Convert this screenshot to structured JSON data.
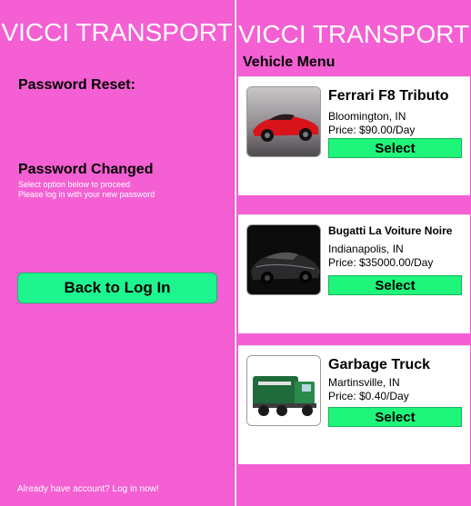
{
  "left": {
    "app_title": "VICCI TRANSPORT",
    "reset_heading": "Password Reset:",
    "changed_heading": "Password Changed",
    "hint_line1": "Select option below to proceed",
    "hint_line2": "Please log in with your new password",
    "back_button": "Back to Log In",
    "footer_link": "Already have account? Log in now!"
  },
  "right": {
    "app_title": "VICCI TRANSPORT",
    "menu_heading": "Vehicle Menu",
    "vehicles": [
      {
        "name": "Ferrari F8 Tributo",
        "location": "Bloomington, IN",
        "price": "Price: $90.00/Day",
        "select_label": "Select"
      },
      {
        "name": "Bugatti La Voiture Noire",
        "location": "Indianapolis, IN",
        "price": "Price: $35000.00/Day",
        "select_label": "Select"
      },
      {
        "name": "Garbage Truck",
        "location": "Martinsville, IN",
        "price": "Price: $0.40/Day",
        "select_label": "Select"
      }
    ]
  },
  "colors": {
    "background": "#f45fd3",
    "button_green": "#1ff58f",
    "select_green": "#1ff57a"
  }
}
